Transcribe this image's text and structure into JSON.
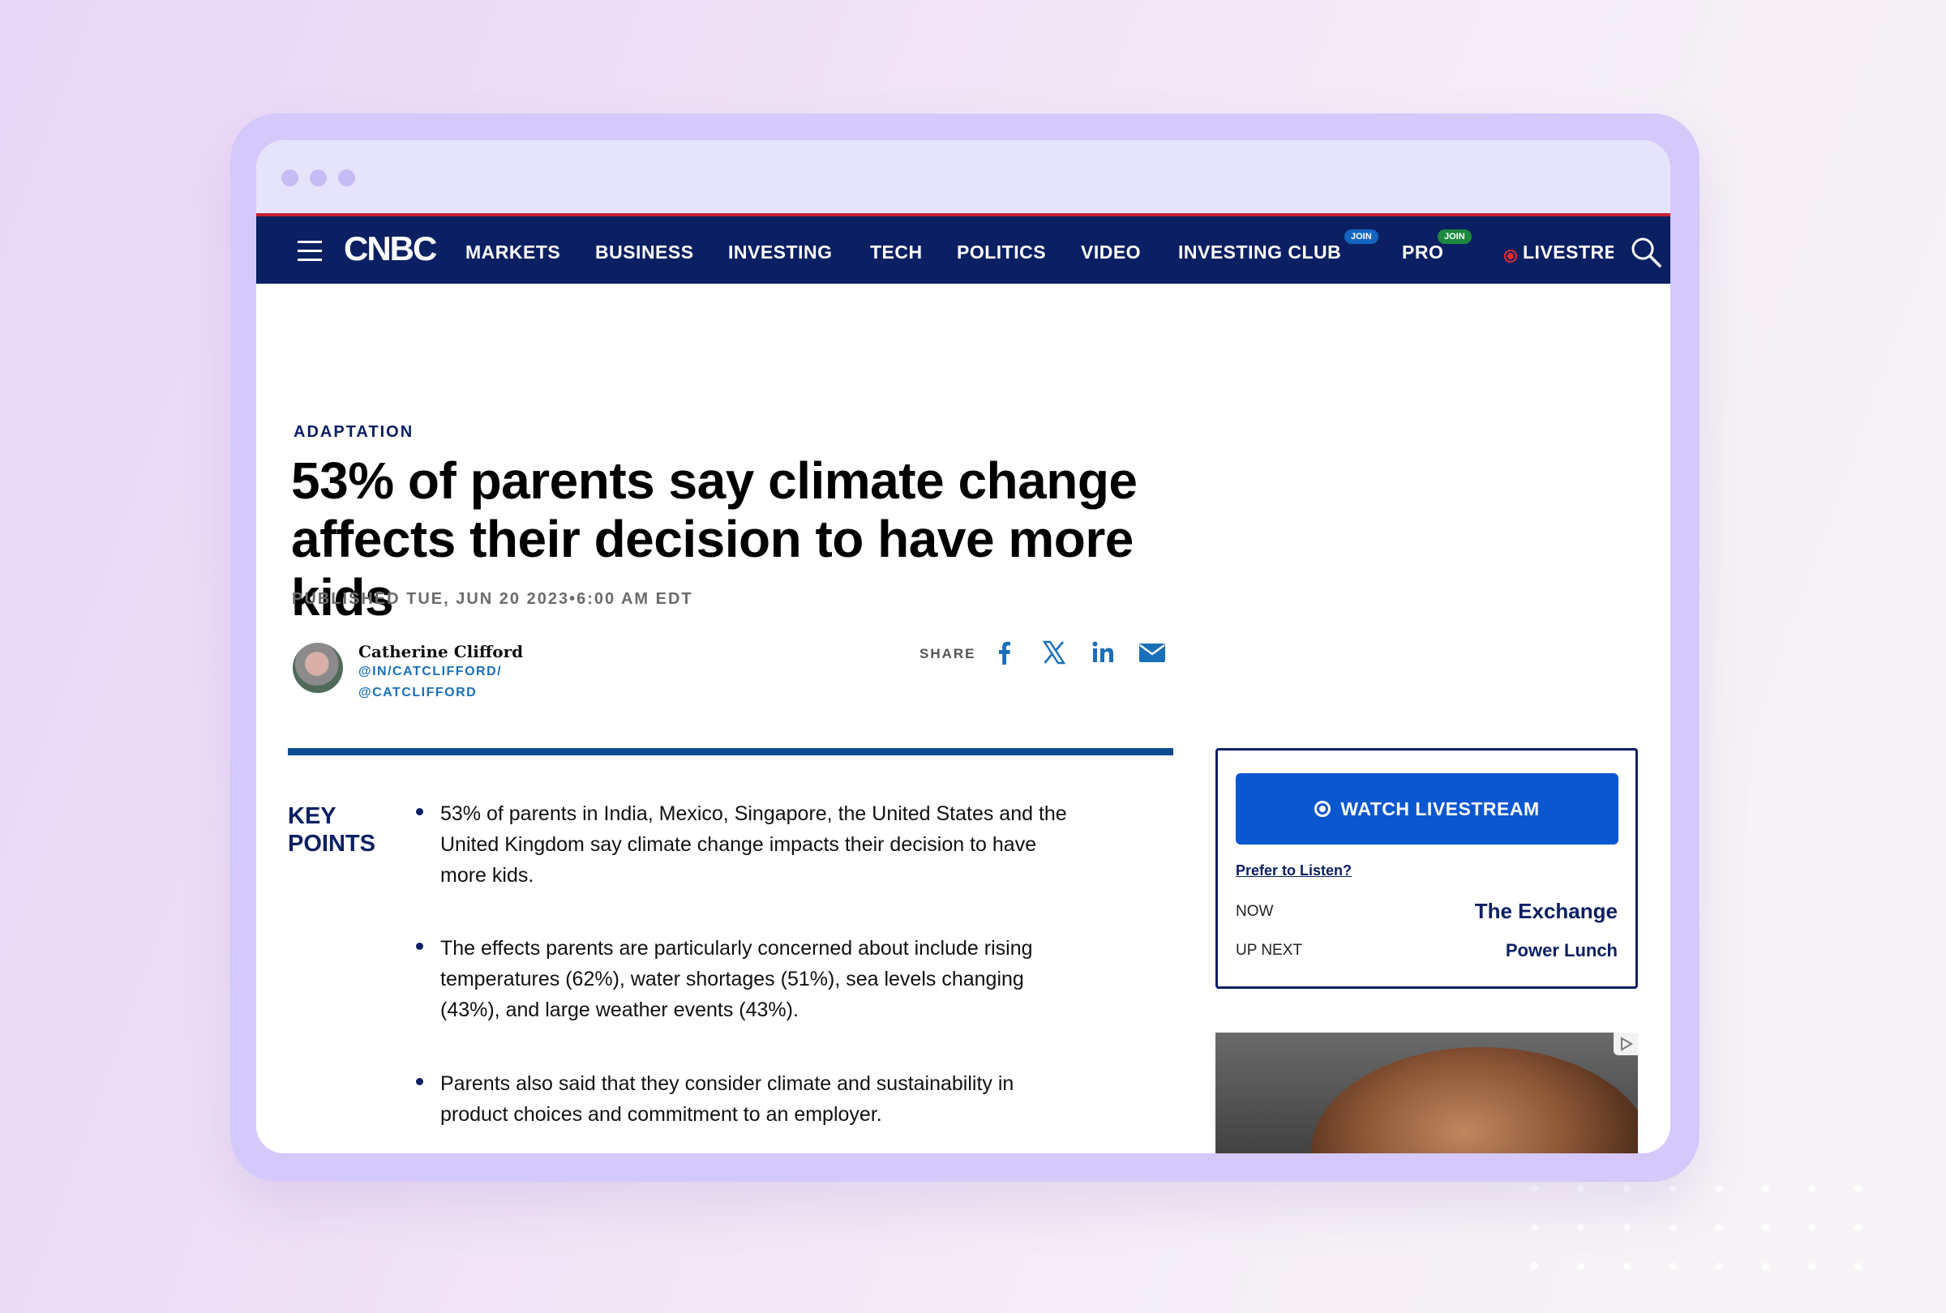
{
  "nav": {
    "brand": "CNBC",
    "items": [
      "MARKETS",
      "BUSINESS",
      "INVESTING",
      "TECH",
      "POLITICS",
      "VIDEO",
      "INVESTING CLUB",
      "PRO"
    ],
    "badges": [
      "JOIN",
      "JOIN"
    ],
    "livestream": "LIVESTRE",
    "colors": {
      "bar": "#0b2063",
      "accent": "#c82033",
      "club_badge": "#1565c0",
      "pro_badge": "#1b8a3e"
    }
  },
  "article": {
    "category": "ADAPTATION",
    "headline": "53% of parents say climate change affects their decision to have more kids",
    "published": "PUBLISHED TUE, JUN 20 2023•6:00 AM EDT",
    "author": {
      "name": "Catherine Clifford",
      "handle_linkedin": "@IN/CATCLIFFORD/",
      "handle_x": "@CATCLIFFORD"
    },
    "share": {
      "label": "SHARE",
      "icons": [
        "facebook-icon",
        "x-icon",
        "linkedin-icon",
        "email-icon"
      ]
    },
    "key_points": {
      "title_line1": "KEY",
      "title_line2": "POINTS",
      "items": [
        {
          "line1": "53% of parents in India, Mexico, Singapore, the United States and the",
          "line2": "United Kingdom say climate change impacts their decision to have",
          "line3": "more kids."
        },
        {
          "line1": "The effects parents are particularly concerned about include rising",
          "line2": "temperatures (62%), water shortages (51%), sea levels changing",
          "line3": "(43%), and large weather events (43%)."
        },
        {
          "line1": "Parents also said that they consider climate and sustainability in",
          "line2": "product choices and commitment to an employer."
        }
      ]
    }
  },
  "sidebar": {
    "watch_label": "WATCH LIVESTREAM",
    "listen_label": "Prefer to Listen?",
    "now_label": "NOW",
    "now_show": "The Exchange",
    "next_label": "UP NEXT",
    "next_show": "Power Lunch"
  }
}
